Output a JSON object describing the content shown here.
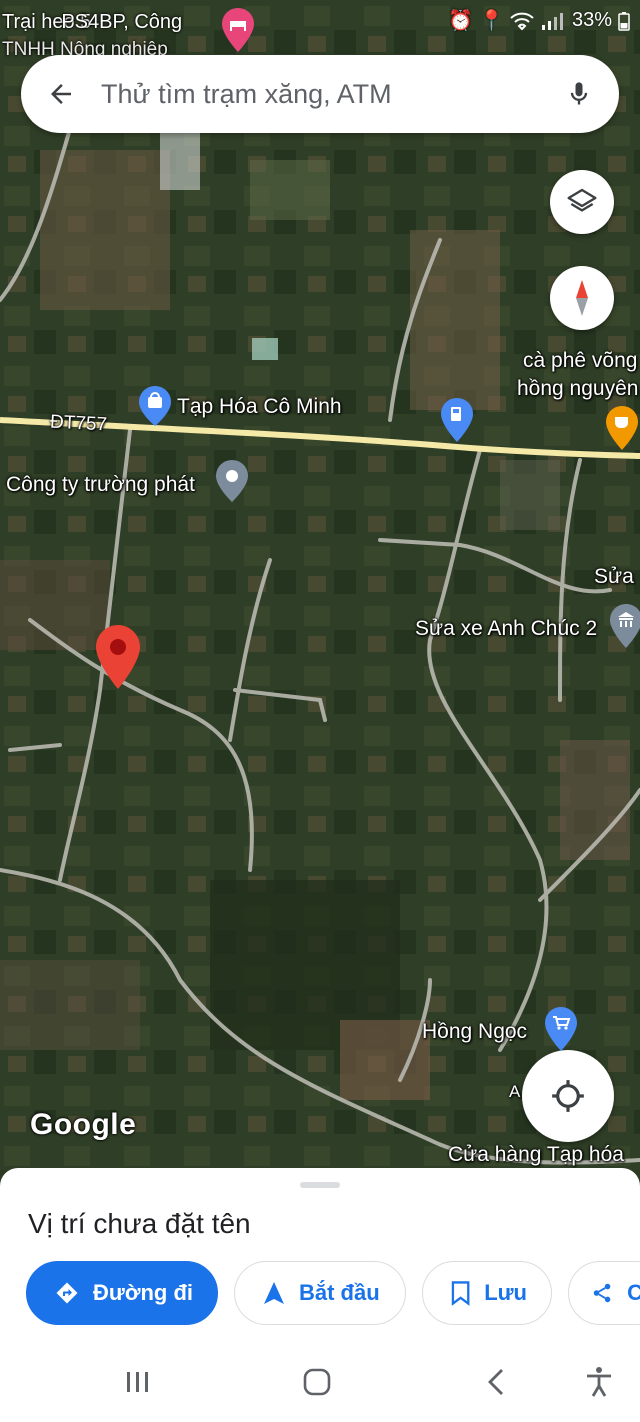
{
  "status_bar": {
    "left_line1": "Trại heo 5",
    "left_line1_overlap": "PS4BP, Công",
    "left_line2": "TNHH Nông nghiệp",
    "battery": "33%"
  },
  "search": {
    "placeholder": "Thử tìm trạm xăng, ATM"
  },
  "map": {
    "road_label": "ĐT757",
    "places": {
      "tap_hoa": "Tạp Hóa Cô Minh",
      "cong_ty": "Công ty trường phát",
      "cafe_line1": "cà phê võng",
      "cafe_line2": "hồng nguyên",
      "sua": "Sửa",
      "sua_xe": "Sửa xe Anh Chúc 2",
      "hong_ngoc": "Hồng Ngọc",
      "a_label": "A",
      "cua_hang": "Cửa hàng Tạp hóa"
    },
    "attribution": "Google"
  },
  "sheet": {
    "title": "Vị trí chưa đặt tên",
    "actions": {
      "directions": "Đường đi",
      "start": "Bắt đầu",
      "save": "Lưu",
      "share": "C"
    }
  },
  "colors": {
    "accent": "#1a73e8",
    "pin_red": "#ea4335",
    "poi_blue": "#4a8af4",
    "poi_orange": "#f29900",
    "road": "#f5e9a8"
  }
}
